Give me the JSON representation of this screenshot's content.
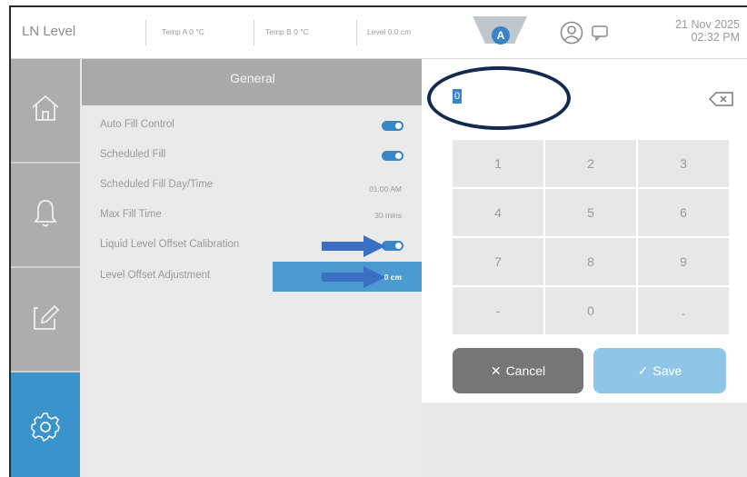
{
  "header": {
    "app_title": "LN Level",
    "temp_a": "Temp A  0 °C",
    "temp_b": "Temp B  0 °C",
    "level": "Level  0.0 cm",
    "alert_letter": "A",
    "date": "21 Nov 2025",
    "time": "02:32 PM"
  },
  "nav": {
    "items": [
      {
        "icon": "home-icon",
        "active": false
      },
      {
        "icon": "bell-icon",
        "active": false
      },
      {
        "icon": "edit-icon",
        "active": false
      },
      {
        "icon": "gear-icon",
        "active": true
      }
    ]
  },
  "settings": {
    "title": "General",
    "rows": [
      {
        "label": "Auto Fill Control",
        "type": "toggle",
        "on": true
      },
      {
        "label": "Scheduled Fill",
        "type": "toggle",
        "on": true
      },
      {
        "label": "Scheduled Fill Day/Time",
        "type": "value",
        "value": "01:00 AM"
      },
      {
        "label": "Max Fill Time",
        "type": "value",
        "value": "30 mins"
      },
      {
        "label": "Liquid Level Offset Calibration",
        "type": "toggle",
        "on": true
      },
      {
        "label": "Level Offset Adjustment",
        "type": "value",
        "value": "0 cm",
        "selected": true
      }
    ]
  },
  "keypad": {
    "entry_value": "0",
    "keys": [
      "1",
      "2",
      "3",
      "4",
      "5",
      "6",
      "7",
      "8",
      "9",
      "-",
      "0",
      "."
    ],
    "cancel_label": "Cancel",
    "save_label": "Save"
  },
  "colors": {
    "accent": "#3a85c7",
    "annotation_arrow": "#3b6fc4",
    "annotation_circle": "#14294f"
  }
}
